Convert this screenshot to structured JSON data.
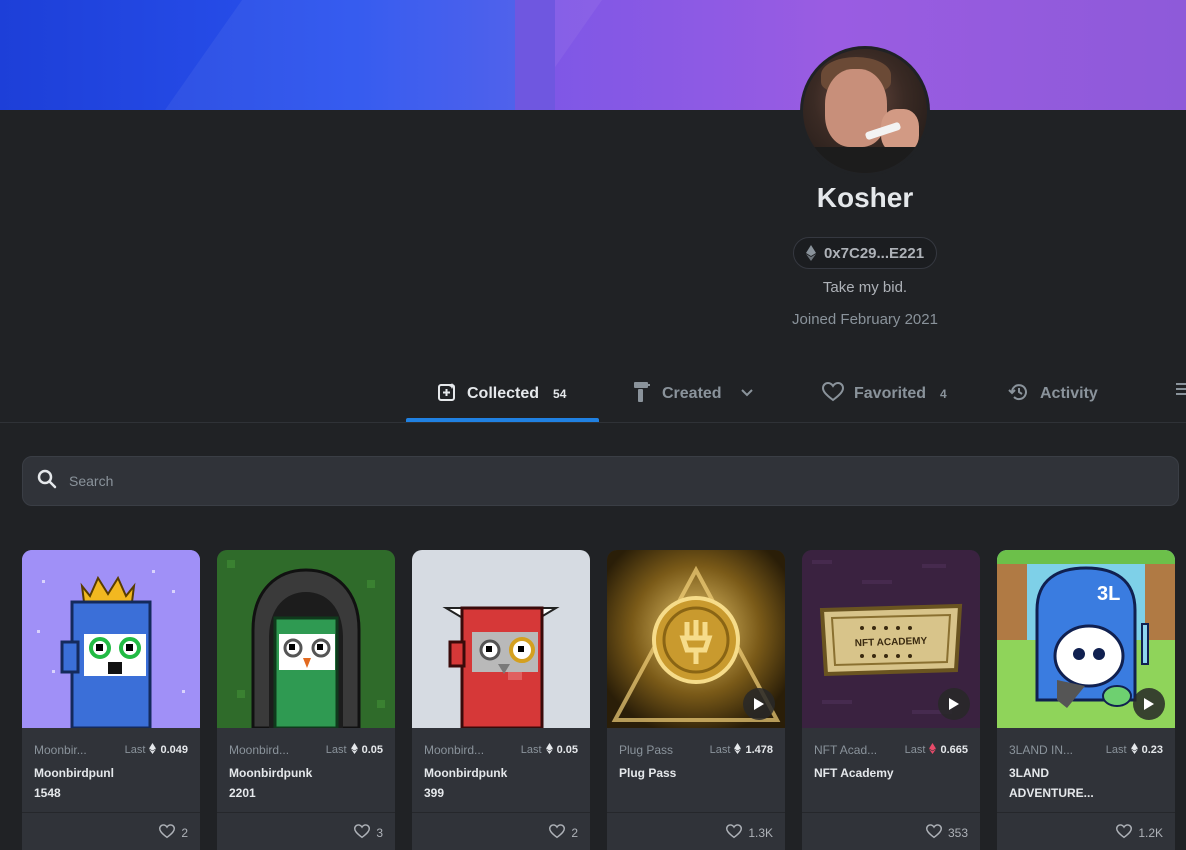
{
  "profile": {
    "name": "Kosher",
    "address": "0x7C29...E221",
    "bio": "Take my bid.",
    "joined": "Joined February 2021"
  },
  "tabs": [
    {
      "label": "Collected",
      "count": "54",
      "icon": "collected-icon"
    },
    {
      "label": "Created",
      "icon": "paintbrush-icon"
    },
    {
      "label": "Favorited",
      "count": "4",
      "icon": "heart-icon"
    },
    {
      "label": "Activity",
      "icon": "history-icon"
    }
  ],
  "search": {
    "placeholder": "Search"
  },
  "last_label": "Last",
  "items": [
    {
      "collection": "Moonbir...",
      "last": "0.049",
      "name_line1": "Moonbirdpunl",
      "name_line2": "1548",
      "likes": "2",
      "currency": "eth"
    },
    {
      "collection": "Moonbird...",
      "last": "0.05",
      "name_line1": "Moonbirdpunk",
      "name_line2": "2201",
      "likes": "3",
      "currency": "eth"
    },
    {
      "collection": "Moonbird...",
      "last": "0.05",
      "name_line1": "Moonbirdpunk",
      "name_line2": "399",
      "likes": "2",
      "currency": "eth"
    },
    {
      "collection": "Plug Pass",
      "last": "1.478",
      "name_line1": "Plug Pass",
      "name_line2": "",
      "likes": "1.3K",
      "currency": "eth"
    },
    {
      "collection": "NFT Acad...",
      "last": "0.665",
      "name_line1": "NFT Academy",
      "name_line2": "",
      "likes": "353",
      "currency": "weth"
    },
    {
      "collection": "3LAND IN...",
      "last": "0.23",
      "name_line1": "3LAND",
      "name_line2": "ADVENTURE...",
      "likes": "1.2K",
      "currency": "eth"
    }
  ],
  "nft_academy_badge": "NFT ACADEMY",
  "colors": {
    "accent": "#2081e2",
    "background": "#202225",
    "card": "#303339",
    "weth": "#e84b6a"
  }
}
